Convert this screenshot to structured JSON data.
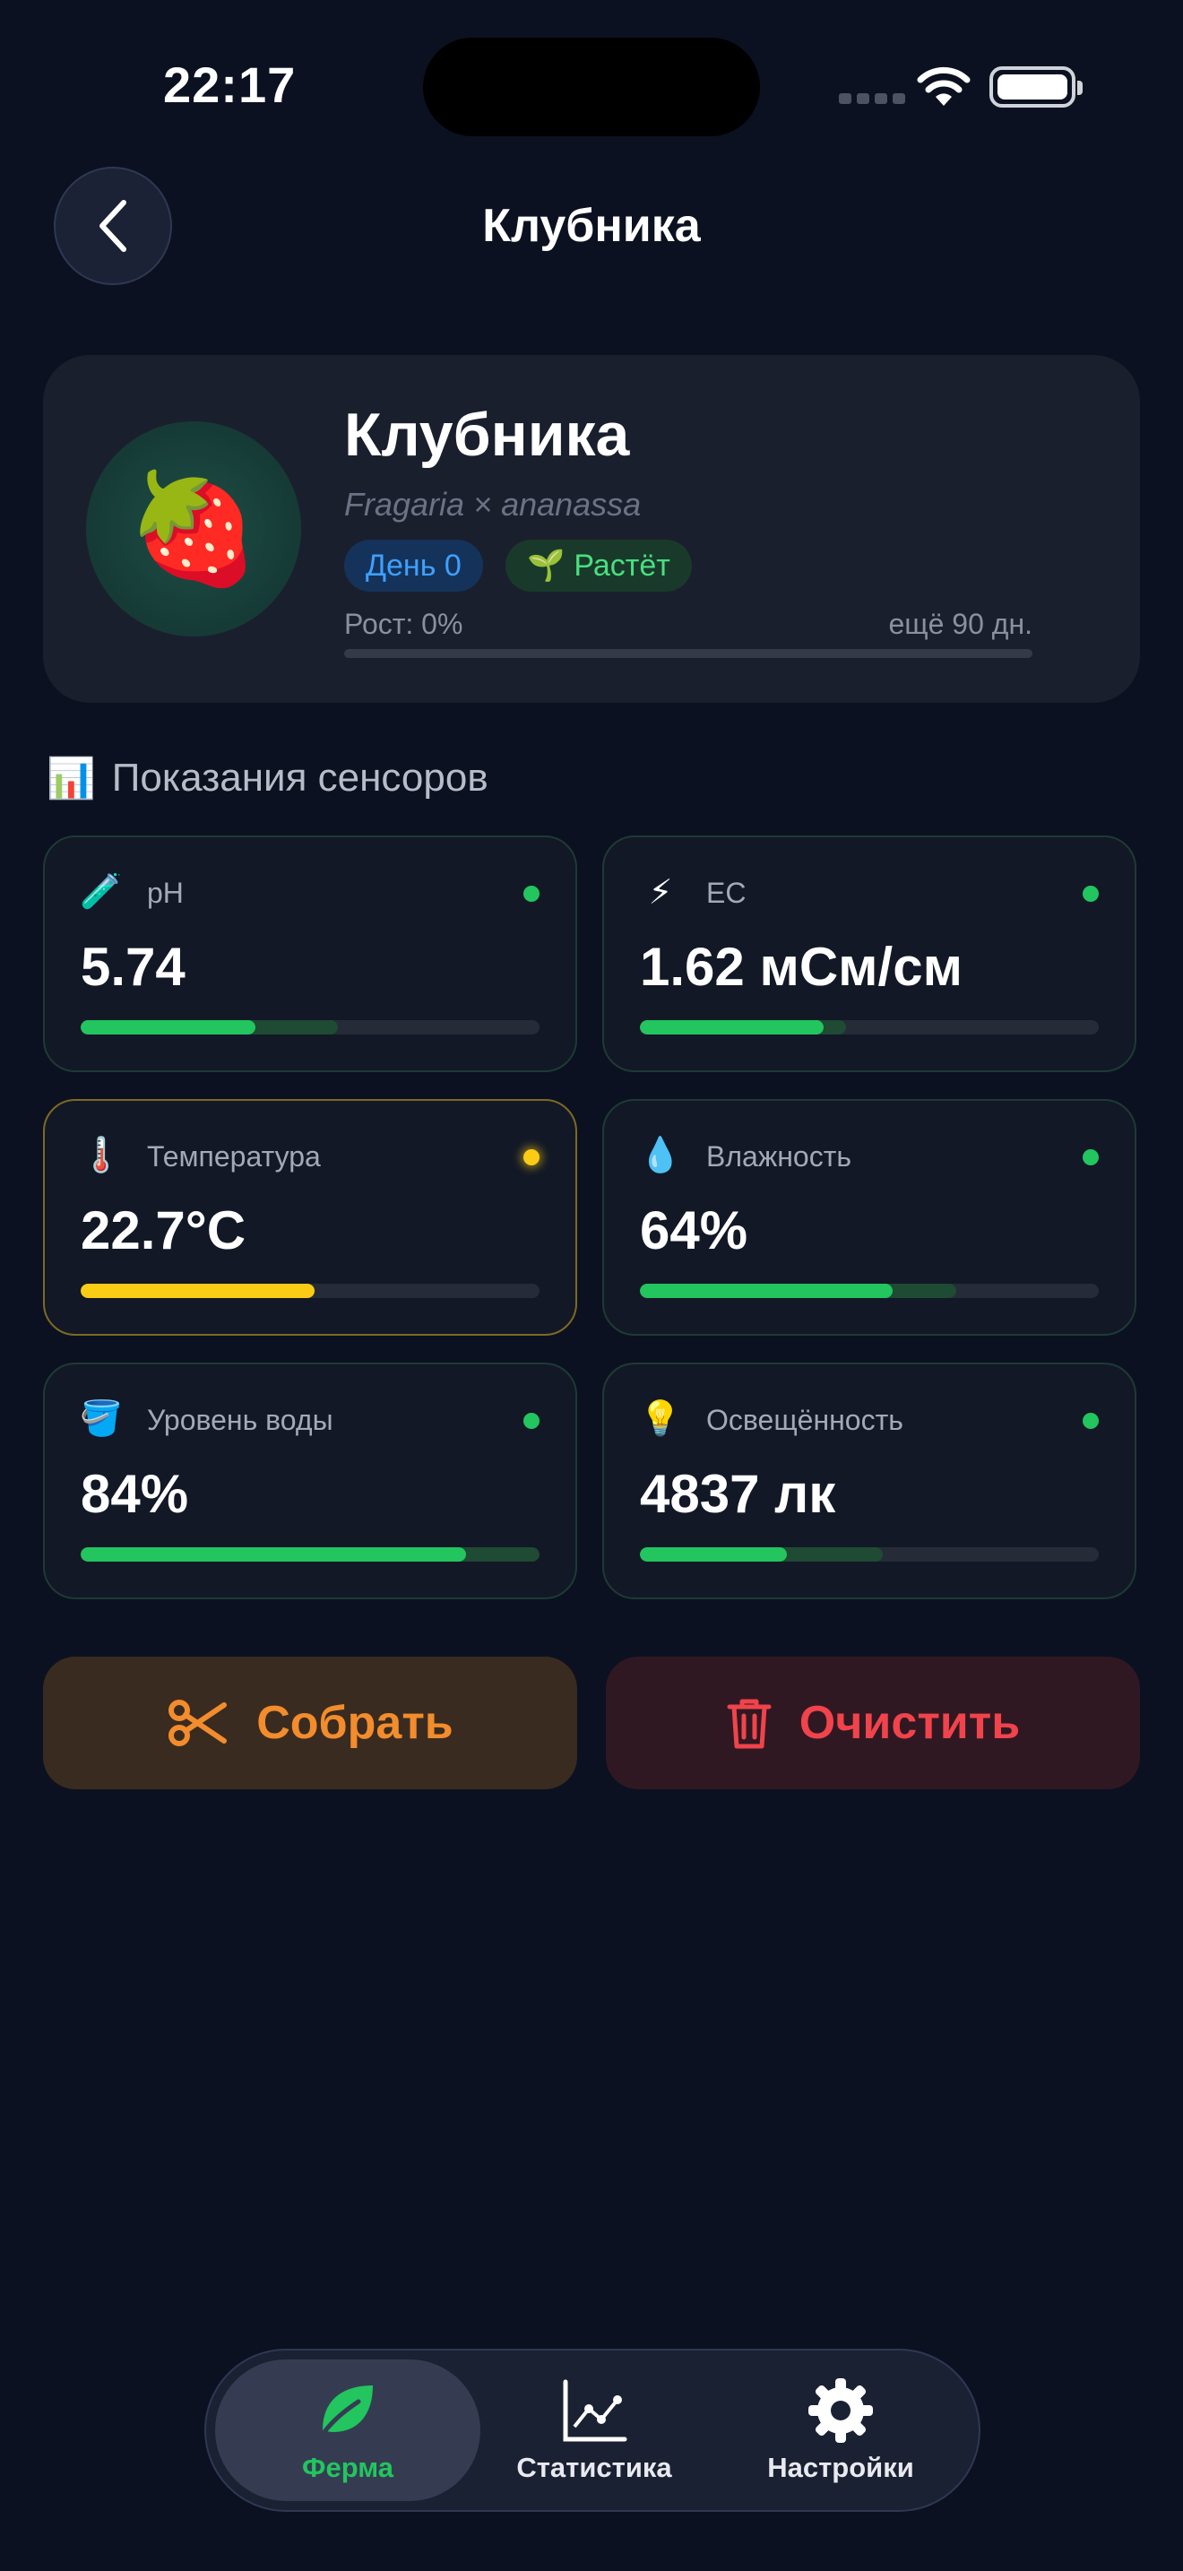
{
  "status_bar": {
    "time": "22:17"
  },
  "nav": {
    "title": "Клубника"
  },
  "plant": {
    "name": "Клубника",
    "latin": "Fragaria × ananassa",
    "emoji": "🍓",
    "day_badge": "День 0",
    "status_badge": "Растёт",
    "status_emoji": "🌱",
    "growth_label": "Рост: 0%",
    "growth_remaining": "ещё 90 дн.",
    "growth_progress": 0
  },
  "sensors_section": {
    "emoji": "📊",
    "title": "Показания сенсоров"
  },
  "sensors": [
    {
      "name": "ph",
      "icon": "test-tube-icon",
      "emoji": "🧪",
      "label": "pH",
      "value": "5.74",
      "status": "ok",
      "fill": 0.38,
      "range_end": 0.56
    },
    {
      "name": "ec",
      "icon": "lightning-icon",
      "emoji": "⚡",
      "label": "EC",
      "value": "1.62 мСм/см",
      "status": "ok",
      "fill": 0.4,
      "range_end": 0.45
    },
    {
      "name": "temperature",
      "icon": "thermometer-icon",
      "emoji": "🌡️",
      "label": "Температура",
      "value": "22.7°C",
      "status": "warning",
      "fill": 0.51,
      "range_end": 0.51
    },
    {
      "name": "humidity",
      "icon": "droplet-icon",
      "emoji": "💧",
      "label": "Влажность",
      "value": "64%",
      "status": "ok",
      "fill": 0.55,
      "range_end": 0.69
    },
    {
      "name": "water-level",
      "icon": "bucket-icon",
      "emoji": "🪣",
      "label": "Уровень воды",
      "value": "84%",
      "status": "ok",
      "fill": 0.84,
      "range_end": 1.0
    },
    {
      "name": "illuminance",
      "icon": "light-bulb-icon",
      "emoji": "💡",
      "label": "Освещённость",
      "value": "4837 лк",
      "status": "ok",
      "fill": 0.32,
      "range_end": 0.53
    }
  ],
  "actions": {
    "harvest_label": "Собрать",
    "clear_label": "Очистить"
  },
  "tabs": [
    {
      "label": "Ферма",
      "icon": "leaf-icon",
      "active": true
    },
    {
      "label": "Статистика",
      "icon": "chart-icon",
      "active": false
    },
    {
      "label": "Настройки",
      "icon": "gear-icon",
      "active": false
    }
  ],
  "colors": {
    "background": "#0b1120",
    "ok": "#22c55e",
    "warning": "#facc15",
    "harvest": "#f28c2c",
    "clear": "#f0434b",
    "info": "#3ea0ff"
  }
}
